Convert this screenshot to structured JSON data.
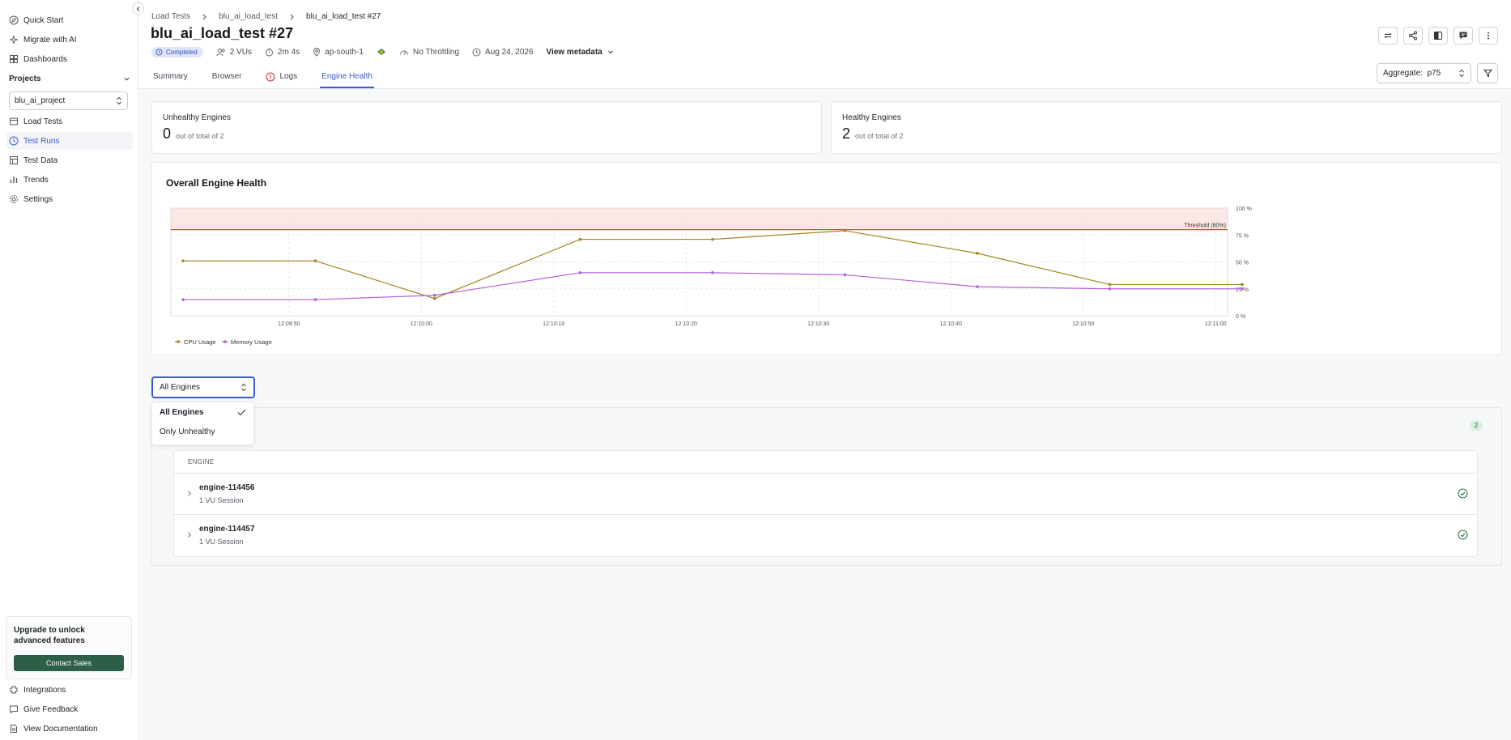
{
  "sidebar": {
    "quick_start": "Quick Start",
    "migrate": "Migrate with AI",
    "dashboards": "Dashboards",
    "projects_label": "Projects",
    "project_value": "blu_ai_project",
    "items": [
      {
        "label": "Load Tests",
        "icon": "load-tests-icon"
      },
      {
        "label": "Test Runs",
        "icon": "test-runs-icon"
      },
      {
        "label": "Test Data",
        "icon": "table-icon"
      },
      {
        "label": "Trends",
        "icon": "bar-chart-icon"
      },
      {
        "label": "Settings",
        "icon": "gear-icon"
      }
    ],
    "upgrade_text": "Upgrade to unlock advanced features",
    "contact_sales": "Contact Sales",
    "integrations": "Integrations",
    "feedback": "Give Feedback",
    "docs": "View Documentation"
  },
  "header": {
    "breadcrumb": [
      "Load Tests",
      "blu_ai_load_test",
      "blu_ai_load_test #27"
    ],
    "title": "blu_ai_load_test #27",
    "status": "Completed",
    "vus": "2 VUs",
    "duration": "2m 4s",
    "region": "ap-south-1",
    "throttling": "No Throttling",
    "date": "Aug 24, 2026",
    "view_metadata": "View metadata"
  },
  "tabs": [
    {
      "label": "Summary"
    },
    {
      "label": "Browser"
    },
    {
      "label": "Logs"
    },
    {
      "label": "Engine Health"
    }
  ],
  "aggregate": {
    "label": "Aggregate:",
    "value": "p75"
  },
  "stats": {
    "unhealthy": {
      "label": "Unhealthy Engines",
      "value": "0",
      "sub": "out of total of 2"
    },
    "healthy": {
      "label": "Healthy Engines",
      "value": "2",
      "sub": "out of total of 2"
    }
  },
  "chart_title": "Overall Engine Health",
  "chart_data": {
    "type": "line",
    "x": [
      "12:09:42",
      "12:09:52",
      "12:10:01",
      "12:10:12",
      "12:10:22",
      "12:10:32",
      "12:10:42",
      "12:10:52",
      "12:11:02"
    ],
    "x_ticks": [
      "12:09:50",
      "12:10:00",
      "12:10:10",
      "12:10:20",
      "12:10:30",
      "12:10:40",
      "12:10:50",
      "12:11:00"
    ],
    "y_ticks": [
      "0 %",
      "25 %",
      "50 %",
      "75 %",
      "100 %"
    ],
    "ylim": [
      0,
      100
    ],
    "threshold": {
      "value": 80,
      "label": "Threshold (80%)"
    },
    "series": [
      {
        "name": "CPU Usage",
        "color": "#a6841f",
        "values": [
          51,
          51,
          16,
          71,
          71,
          79,
          58,
          29,
          29
        ]
      },
      {
        "name": "Memory Usage",
        "color": "#b660d6",
        "values": [
          15,
          15,
          19,
          40,
          40,
          38,
          27,
          25,
          25
        ]
      }
    ],
    "grid": true,
    "legend": "bottom-left"
  },
  "filter": {
    "value": "All Engines",
    "options": [
      {
        "label": "All Engines",
        "selected": true
      },
      {
        "label": "Only Unhealthy",
        "selected": false
      }
    ]
  },
  "engines": {
    "count": "2",
    "column": "ENGINE",
    "rows": [
      {
        "name": "engine-114456",
        "sub": "1 VU Session"
      },
      {
        "name": "engine-114457",
        "sub": "1 VU Session"
      }
    ]
  }
}
